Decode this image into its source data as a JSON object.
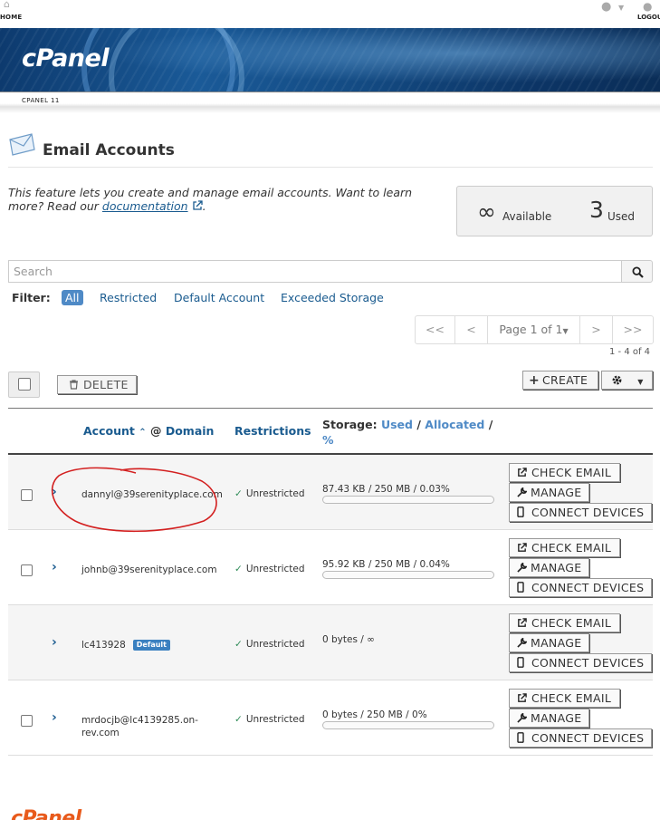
{
  "topbar": {
    "home_label": "HOME",
    "logout_label": "LOGOU",
    "home_icon": "house-icon",
    "user_icon": "user-icon",
    "logout_icon": "logout-icon"
  },
  "banner": {
    "logo_text": "cPanel",
    "version_text": "CPANEL 11"
  },
  "page": {
    "title": "Email Accounts",
    "title_icon": "envelope-icon",
    "intro_text": "This feature lets you create and manage email accounts. Want to learn more? Read our",
    "doc_link": "documentation",
    "intro_end": "."
  },
  "stats": {
    "available_value": "∞",
    "available_label": "Available",
    "used_value": "3",
    "used_label": "Used"
  },
  "search": {
    "placeholder": "Search",
    "icon": "search-icon"
  },
  "filter": {
    "label": "Filter:",
    "options": [
      "All",
      "Restricted",
      "Default Account",
      "Exceeded Storage"
    ],
    "active": "All"
  },
  "pagination": {
    "first": "<<",
    "prev": "<",
    "page_label": "Page 1 of 1",
    "next": ">",
    "last": ">>",
    "range_text": "1 - 4 of 4"
  },
  "toolbar": {
    "delete_label": "DELETE",
    "create_label": "CREATE"
  },
  "table": {
    "headers": {
      "account": "Account",
      "at_sign": "@",
      "domain": "Domain",
      "restrictions": "Restrictions",
      "storage": "Storage:",
      "used": "Used",
      "slash1": "/",
      "allocated": "Allocated",
      "slash2": "/",
      "percent": "%"
    },
    "rows": [
      {
        "account": "dannyl@39serenityplace.com",
        "badge": "",
        "restriction": "Unrestricted",
        "storage": "87.43 KB / 250 MB / 0.03%",
        "usage_fraction": 0.0003,
        "show_bar": true,
        "has_checkbox": true
      },
      {
        "account": "johnb@39serenityplace.com",
        "badge": "",
        "restriction": "Unrestricted",
        "storage": "95.92 KB / 250 MB / 0.04%",
        "usage_fraction": 0.0004,
        "show_bar": true,
        "has_checkbox": true
      },
      {
        "account": "lc413928",
        "badge": "Default",
        "restriction": "Unrestricted",
        "storage": "0 bytes / ∞",
        "usage_fraction": 0,
        "show_bar": false,
        "has_checkbox": false
      },
      {
        "account": "mrdocjb@lc4139285.on-rev.com",
        "badge": "",
        "restriction": "Unrestricted",
        "storage": "0 bytes / 250 MB / 0%",
        "usage_fraction": 0,
        "show_bar": true,
        "has_checkbox": true
      }
    ],
    "row_buttons": {
      "check_email": "CHECK EMAIL",
      "manage": "MANAGE",
      "connect_devices": "CONNECT DEVICES"
    }
  },
  "footer": {
    "logo_text": "cPanel"
  },
  "colors": {
    "link": "#1a5b8f",
    "accent": "#4f8ac6",
    "annotation": "#d32020",
    "footer_logo": "#e85a1b"
  }
}
